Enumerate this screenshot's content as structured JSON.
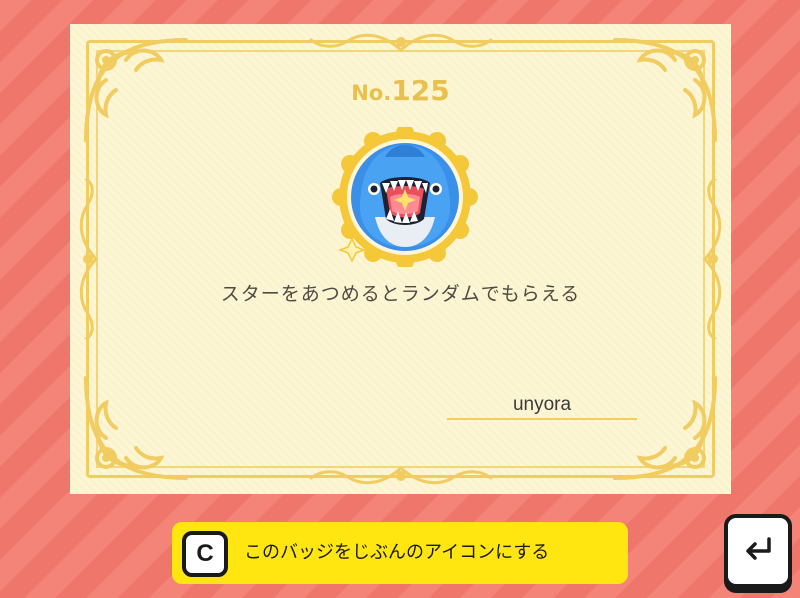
{
  "certificate": {
    "number_prefix": "No.",
    "number": "125",
    "badge_icon": "shark-icon",
    "description": "スターをあつめるとランダムでもらえる",
    "owner_name": "unyora"
  },
  "action_bar": {
    "key_label": "C",
    "label": "このバッジをじぶんのアイコンにする"
  },
  "enter_key": {
    "icon": "enter-return-icon"
  },
  "colors": {
    "background": "#f58478",
    "paper": "#fdf6d4",
    "gold": "#f0cc61",
    "action_yellow": "#ffe611",
    "shark_blue": "#3a8fe8"
  }
}
